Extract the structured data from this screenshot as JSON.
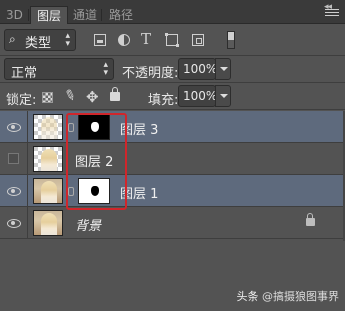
{
  "tabs": {
    "t3d": "3D",
    "layers": "图层",
    "channels": "通道",
    "paths": "路径",
    "collapse": "◂◂"
  },
  "filter": {
    "kind_label": "类型",
    "icons": [
      "image-filter-icon",
      "adjustment-filter-icon",
      "type-filter-icon",
      "shape-filter-icon",
      "smart-object-filter-icon",
      "filter-toggle-icon"
    ],
    "type_glyph": "T"
  },
  "blend": {
    "mode": "正常",
    "opacity_label": "不透明度:",
    "opacity_value": "100%"
  },
  "lock": {
    "label": "锁定:",
    "fill_label": "填充:",
    "fill_value": "100%",
    "move_glyph": "✥",
    "brush_glyph": "✎"
  },
  "layers": [
    {
      "name": "图层 3",
      "visible": true,
      "selected": true,
      "thumb": "checker",
      "mask": "black"
    },
    {
      "name": "图层 2",
      "visible": false,
      "selected": false,
      "thumb": "checker",
      "mask": null
    },
    {
      "name": "图层 1",
      "visible": true,
      "selected": true,
      "thumb": "photo",
      "mask": "white"
    },
    {
      "name": "背景",
      "visible": true,
      "selected": false,
      "thumb": "photo",
      "mask": null,
      "locked": true
    }
  ],
  "colors": {
    "highlight": "#d0262b",
    "selected_row": "#5e6a7d",
    "panel": "#535353"
  },
  "watermark": {
    "prefix": "头条",
    "handle": "@搞摄狼图事界"
  }
}
